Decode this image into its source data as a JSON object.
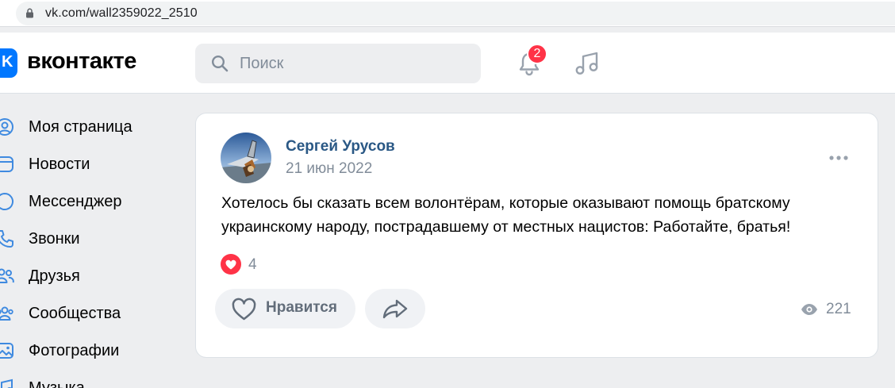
{
  "browser": {
    "url": "vk.com/wall2359022_2510"
  },
  "header": {
    "logo_letter": "K",
    "logo_text": "вконтакте",
    "search_placeholder": "Поиск",
    "notifications_count": "2",
    "icons": [
      "search-icon",
      "bell-icon",
      "music-icon"
    ]
  },
  "menu": {
    "items": [
      {
        "label": "Моя страница",
        "icon": "user-circle-icon"
      },
      {
        "label": "Новости",
        "icon": "news-icon"
      },
      {
        "label": "Мессенджер",
        "icon": "chat-icon"
      },
      {
        "label": "Звонки",
        "icon": "phone-icon"
      },
      {
        "label": "Друзья",
        "icon": "friends-icon"
      },
      {
        "label": "Сообщества",
        "icon": "communities-icon"
      },
      {
        "label": "Фотографии",
        "icon": "photo-icon"
      },
      {
        "label": "Музыка",
        "icon": "music-icon"
      }
    ]
  },
  "post": {
    "author": "Сергей Урусов",
    "date": "21 июн 2022",
    "text": "Хотелось бы сказать всем волонтёрам, которые оказывают помощь братскому украинскому народу, пострадавшему от местных нацистов: Работайте, братья!",
    "reactions_count": "4",
    "like_label": "Нравится",
    "views_count": "221"
  },
  "colors": {
    "accent": "#0077ff",
    "link": "#2a5885",
    "secondary_text": "#818c99",
    "badge": "#ff3347",
    "background": "#edeef0"
  }
}
